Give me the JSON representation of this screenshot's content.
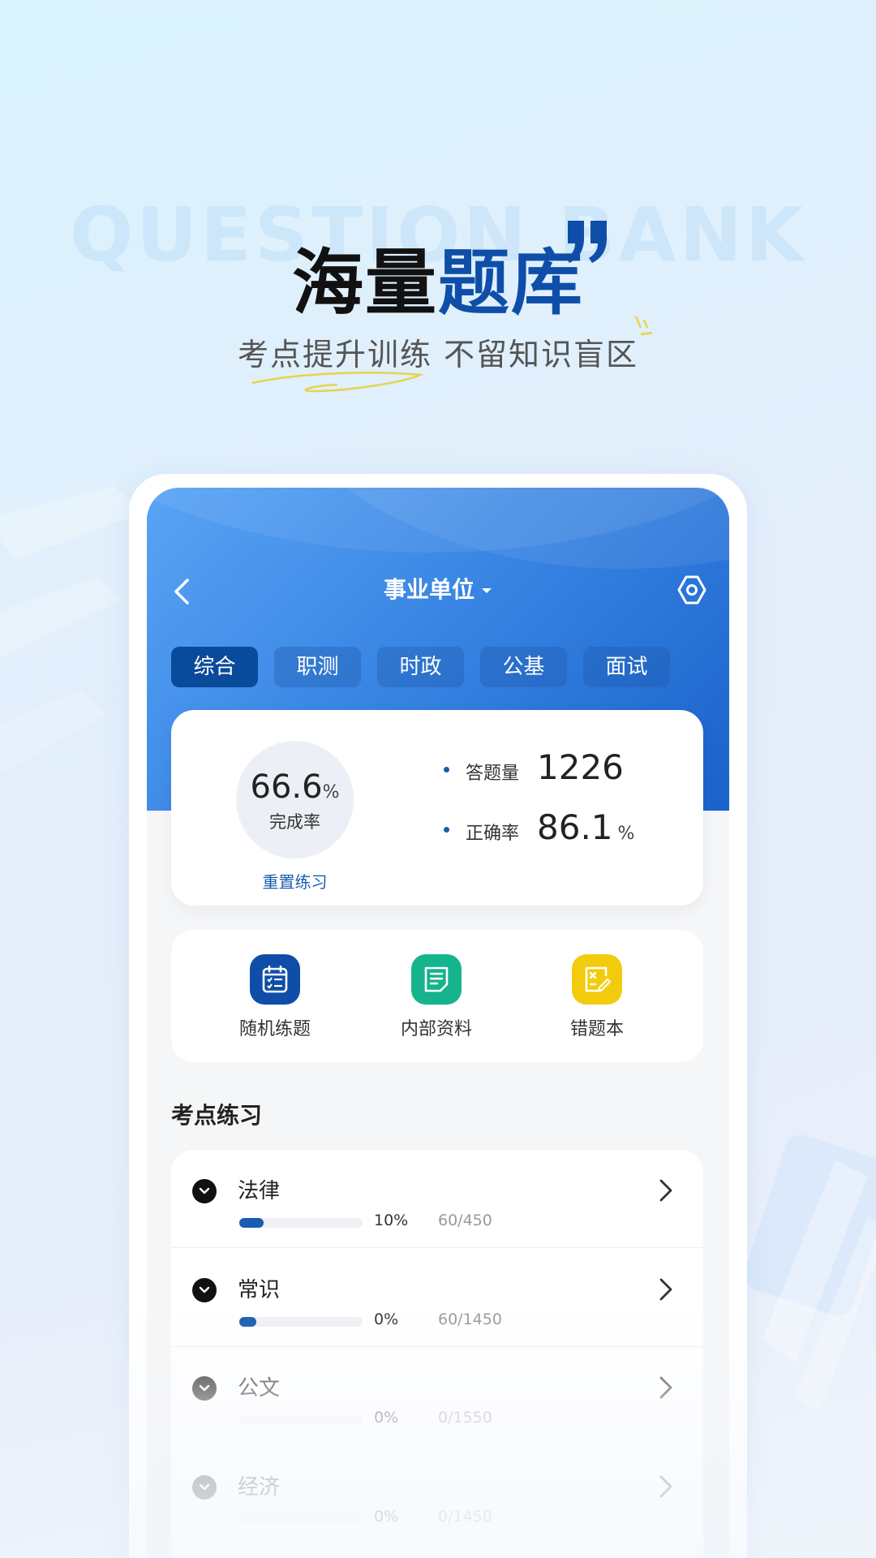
{
  "hero": {
    "bg_text": "QUESTION BANK",
    "title_plain": "海量",
    "title_accent": "题库",
    "subtitle": "考点提升训练 不留知识盲区"
  },
  "app": {
    "nav": {
      "title": "事业单位",
      "back_icon": "chevron-left-icon",
      "settings_icon": "settings-icon"
    },
    "tabs": [
      {
        "label": "综合",
        "active": true
      },
      {
        "label": "职测",
        "active": false
      },
      {
        "label": "时政",
        "active": false
      },
      {
        "label": "公基",
        "active": false
      },
      {
        "label": "面试",
        "active": false
      }
    ],
    "stats": {
      "completion_value": "66.6",
      "completion_unit": "%",
      "completion_label": "完成率",
      "reset_label": "重置练习",
      "answered_label": "答题量",
      "answered_value": "1226",
      "accuracy_label": "正确率",
      "accuracy_value": "86.1",
      "accuracy_unit": "%"
    },
    "tools": [
      {
        "label": "随机练题",
        "icon": "calendar-checklist-icon",
        "color": "#0f4ea8"
      },
      {
        "label": "内部资料",
        "icon": "document-icon",
        "color": "#16b48c"
      },
      {
        "label": "错题本",
        "icon": "edit-note-icon",
        "color": "#f2cc0c"
      }
    ],
    "section_title": "考点练习",
    "topics": [
      {
        "title": "法律",
        "percent": "10%",
        "count": "60/450",
        "progress": 0.2
      },
      {
        "title": "常识",
        "percent": "0%",
        "count": "60/1450",
        "progress": 0.14
      },
      {
        "title": "公文",
        "percent": "0%",
        "count": "0/1550",
        "progress": 0
      },
      {
        "title": "经济",
        "percent": "0%",
        "count": "0/1450",
        "progress": 0
      }
    ],
    "colors": {
      "primary": "#1a5cb0",
      "accent_dark": "#0a4a9a"
    }
  }
}
